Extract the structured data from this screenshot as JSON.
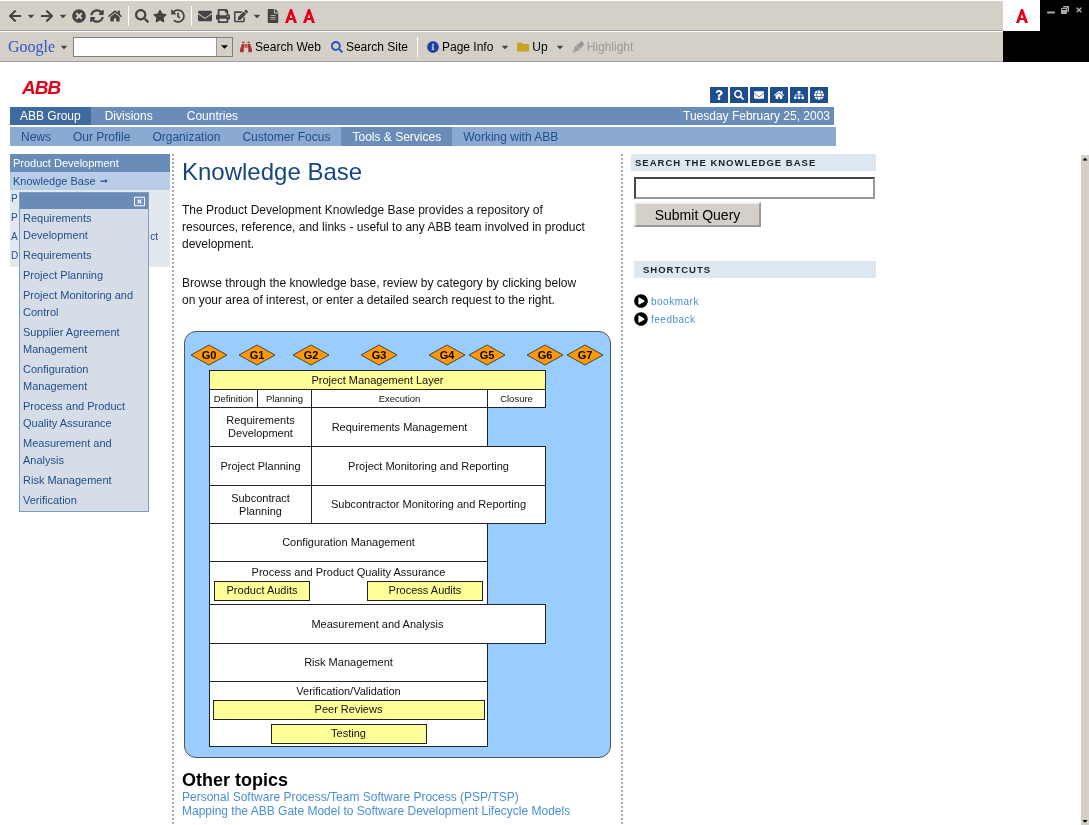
{
  "browser": {
    "google_logo": "Google",
    "search_web": "Search Web",
    "search_site": "Search Site",
    "page_info": "Page Info",
    "up": "Up",
    "highlight": {
      "label": "Highlight",
      "disabled": true
    }
  },
  "logo": "ABB",
  "nav_primary": {
    "items": [
      {
        "label": "ABB Group",
        "selected": true
      },
      {
        "label": "Divisions",
        "selected": false
      },
      {
        "label": "Countries",
        "selected": false
      }
    ],
    "date": "Tuesday February 25, 2003"
  },
  "nav_secondary": [
    {
      "label": "News",
      "selected": false
    },
    {
      "label": "Our Profile",
      "selected": false
    },
    {
      "label": "Organization",
      "selected": false
    },
    {
      "label": "Customer Focus",
      "selected": false
    },
    {
      "label": "Tools & Services",
      "selected": true
    },
    {
      "label": "Working with ABB",
      "selected": false
    }
  ],
  "sidebar": {
    "items": [
      {
        "label": "Product Development",
        "kind": "section"
      },
      {
        "label": "Knowledge Base",
        "kind": "link",
        "selected": true
      }
    ],
    "covered_items": [
      {
        "left": "P"
      },
      {
        "left": "P"
      },
      {
        "left": "A",
        "right": "ct"
      },
      {
        "left": "D"
      }
    ]
  },
  "popup_menu": {
    "items": [
      "Requirements Development",
      "Requirements",
      "Project Planning",
      "Project Monitoring and Control",
      "Supplier Agreement Management",
      "Configuration Management",
      "Process and Product Quality Assurance",
      "Measurement and Analysis",
      "Risk Management",
      "Verification"
    ]
  },
  "main": {
    "title": "Knowledge Base",
    "paragraphs": [
      "The Product Development Knowledge Base provides a repository of resources, reference, and links - useful to any ABB team involved in product development.",
      "Browse through the knowledge base, review by category by clicking below on your area of interest, or enter a detailed search request to the right."
    ],
    "diagram": {
      "gates": [
        "G0",
        "G1",
        "G2",
        "G3",
        "G4",
        "G5",
        "G6",
        "G7"
      ],
      "blocks": [
        {
          "label": "Project Management Layer",
          "kind": "full",
          "highlight": true
        },
        {
          "label": "Definition",
          "kind": "phase"
        },
        {
          "label": "Planning",
          "kind": "phase"
        },
        {
          "label": "Execution",
          "kind": "phase"
        },
        {
          "label": "Closure",
          "kind": "phase"
        },
        {
          "label": "Requirements Development",
          "kind": "left"
        },
        {
          "label": "Requirements Management",
          "kind": "middle"
        },
        {
          "label": "Project Planning",
          "kind": "left"
        },
        {
          "label": "Project Monitoring and Reporting",
          "kind": "wide"
        },
        {
          "label": "Subcontract Planning",
          "kind": "left"
        },
        {
          "label": "Subcontractor Monitoring and Reporting",
          "kind": "wide"
        },
        {
          "label": "Configuration Management",
          "kind": "core"
        },
        {
          "label": "Process and Product Quality Assurance",
          "kind": "core_row",
          "subs": [
            "Product Audits",
            "Process Audits"
          ]
        },
        {
          "label": "Measurement and Analysis",
          "kind": "full"
        },
        {
          "label": "Risk Management",
          "kind": "core"
        },
        {
          "label": "Verification/Validation",
          "kind": "core_stack",
          "subs": [
            "Peer Reviews",
            "Testing"
          ]
        }
      ]
    },
    "other_topics": {
      "title": "Other topics",
      "links": [
        "Personal Software Process/Team Software Process (PSP/TSP)",
        "Mapping the ABB Gate Model to Software Development Lifecycle Models"
      ]
    }
  },
  "right": {
    "search_heading": "SEARCH THE KNOWLEDGE BASE",
    "submit": "Submit Query",
    "shortcuts_heading": "SHORTCUTS",
    "shortcuts": [
      "bookmark",
      "feedback"
    ]
  }
}
